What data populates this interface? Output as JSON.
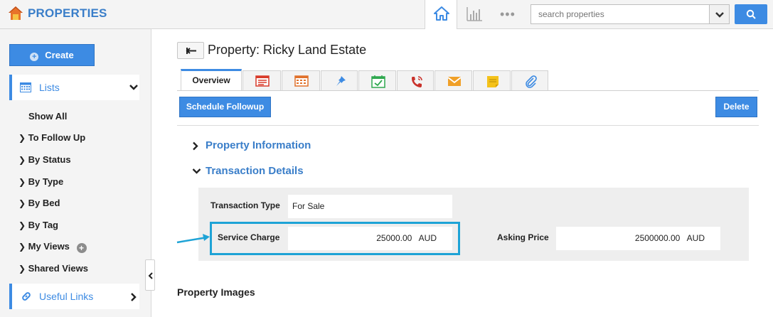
{
  "app": {
    "title": "PROPERTIES"
  },
  "topnav": {
    "more_label": "•••",
    "search_placeholder": "search properties"
  },
  "sidebar": {
    "create_label": "Create",
    "lists_label": "Lists",
    "items": [
      {
        "label": "Show All",
        "arrow": false
      },
      {
        "label": "To Follow Up",
        "arrow": true
      },
      {
        "label": "By Status",
        "arrow": true
      },
      {
        "label": "By Type",
        "arrow": true
      },
      {
        "label": "By Bed",
        "arrow": true
      },
      {
        "label": "By Tag",
        "arrow": true
      },
      {
        "label": "My Views",
        "arrow": true
      },
      {
        "label": "Shared Views",
        "arrow": true
      }
    ],
    "useful_links_label": "Useful Links"
  },
  "page": {
    "title": "Property: Ricky Land Estate",
    "tabs": [
      {
        "label": "Overview",
        "icon": "overview"
      },
      {
        "label": "",
        "icon": "list-icon"
      },
      {
        "label": "",
        "icon": "calendar-grid-icon"
      },
      {
        "label": "",
        "icon": "pin-icon"
      },
      {
        "label": "",
        "icon": "calendar-check-icon"
      },
      {
        "label": "",
        "icon": "phone-icon"
      },
      {
        "label": "",
        "icon": "mail-icon"
      },
      {
        "label": "",
        "icon": "note-icon"
      },
      {
        "label": "",
        "icon": "paperclip-icon"
      }
    ],
    "schedule_followup_label": "Schedule Followup",
    "delete_label": "Delete",
    "sections": {
      "property_information": "Property Information",
      "transaction_details": "Transaction Details"
    },
    "transaction": {
      "type_label": "Transaction Type",
      "type_value": "For Sale",
      "service_charge_label": "Service Charge",
      "service_charge_value": "25000.00",
      "service_charge_currency": "AUD",
      "asking_price_label": "Asking Price",
      "asking_price_value": "2500000.00",
      "asking_price_currency": "AUD"
    },
    "property_images_label": "Property Images"
  },
  "colors": {
    "accent": "#3d8be3",
    "highlight": "#1ea3d6",
    "link": "#3a7ec9"
  }
}
